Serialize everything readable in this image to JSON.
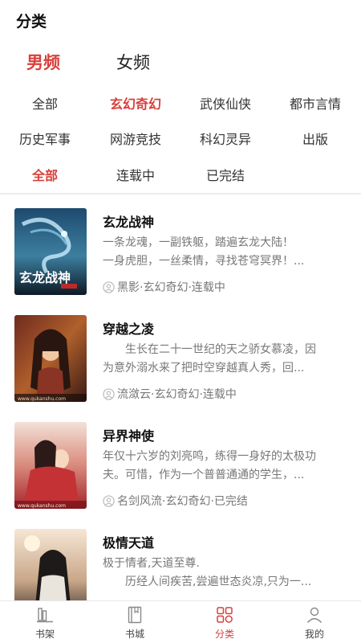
{
  "header": {
    "title": "分类"
  },
  "gender_tabs": [
    {
      "label": "男频",
      "active": true
    },
    {
      "label": "女频",
      "active": false
    }
  ],
  "genre_rows": [
    [
      "全部",
      "玄幻奇幻",
      "武侠仙侠",
      "都市言情"
    ],
    [
      "历史军事",
      "网游竞技",
      "科幻灵异",
      "出版"
    ]
  ],
  "selected_genre": "玄幻奇幻",
  "status_filters": [
    "全部",
    "连载中",
    "已完结"
  ],
  "selected_status": "全部",
  "books": [
    {
      "title": "玄龙战神",
      "desc": [
        "一条龙魂，一副铁躯，踏遍玄龙大陆！",
        "一身虎胆，一丝柔情，寻找苍穹冥界！..."
      ],
      "meta": "黑影·玄幻奇幻·连载中",
      "cover_text": "玄龙战神"
    },
    {
      "title": "穿越之凌",
      "desc": [
        "　　生长在二十一世纪的天之骄女慕凌，因",
        "为意外溺水来了把时空穿越真人秀，回..."
      ],
      "meta": "流潋云·玄幻奇幻·连载中",
      "cover_text": "www.qukanshu.com"
    },
    {
      "title": "异界神使",
      "desc": [
        "年仅十六岁的刘亮鸣，练得一身好的太极功",
        "夫。可惜，作为一个普普通通的学生，..."
      ],
      "meta": "名剑风流·玄幻奇幻·已完结",
      "cover_text": "www.qukanshu.com"
    },
    {
      "title": "极情天道",
      "desc": [
        "极于情者,天道至尊.",
        "　　历经人间疾苦,尝遍世态炎凉,只为一..."
      ],
      "meta": "",
      "cover_text": ""
    }
  ],
  "tabbar": [
    {
      "label": "书架",
      "icon": "bookshelf-icon",
      "active": false
    },
    {
      "label": "书城",
      "icon": "bookstore-icon",
      "active": false
    },
    {
      "label": "分类",
      "icon": "category-grid-icon",
      "active": true
    },
    {
      "label": "我的",
      "icon": "profile-icon",
      "active": false
    }
  ],
  "colors": {
    "accent": "#d8403b",
    "text": "#222222",
    "muted": "#777777",
    "divider": "#ececec"
  }
}
